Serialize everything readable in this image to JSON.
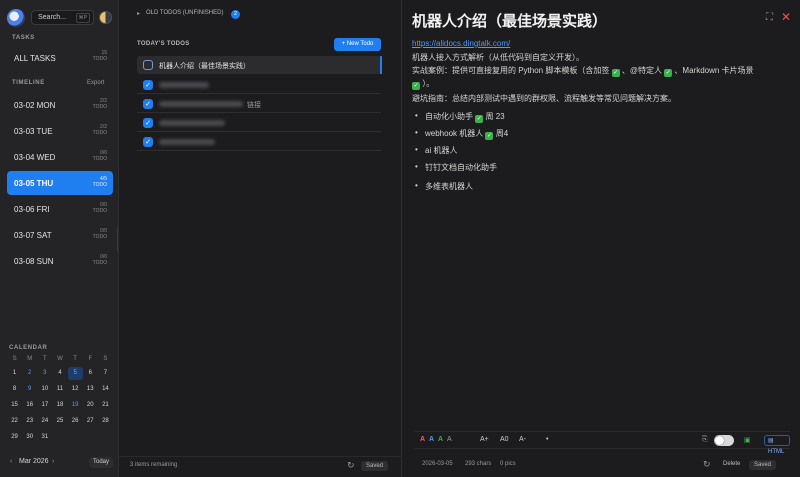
{
  "sidebar": {
    "search_placeholder": "Search...",
    "search_shortcut": "⌘P",
    "tasks_label": "TASKS",
    "all_tasks": {
      "label": "ALL TASKS",
      "count": "15",
      "unit": "TODO"
    },
    "timeline_label": "TIMELINE",
    "export_label": "Export",
    "days": [
      {
        "label": "03-02 MON",
        "count": "2/2",
        "unit": "TODO",
        "active": false
      },
      {
        "label": "03-03 TUE",
        "count": "2/2",
        "unit": "TODO",
        "active": false
      },
      {
        "label": "03-04 WED",
        "count": "0/0",
        "unit": "TODO",
        "active": false
      },
      {
        "label": "03-05 THU",
        "count": "4/5",
        "unit": "TODO",
        "active": true
      },
      {
        "label": "03-06 FRI",
        "count": "0/0",
        "unit": "TODO",
        "active": false
      },
      {
        "label": "03-07 SAT",
        "count": "0/0",
        "unit": "TODO",
        "active": false
      },
      {
        "label": "03-08 SUN",
        "count": "0/0",
        "unit": "TODO",
        "active": false
      }
    ],
    "calendar": {
      "label": "CALENDAR",
      "weekdays": [
        "S",
        "M",
        "T",
        "W",
        "T",
        "F",
        "S"
      ],
      "leading_blanks": 0,
      "days": [
        "1",
        "2",
        "3",
        "4",
        "5",
        "6",
        "7",
        "8",
        "9",
        "10",
        "11",
        "12",
        "13",
        "14",
        "15",
        "16",
        "17",
        "18",
        "19",
        "20",
        "21",
        "22",
        "23",
        "24",
        "25",
        "26",
        "27",
        "28",
        "29",
        "30",
        "31"
      ],
      "blue_days": [
        "2",
        "3",
        "9",
        "19"
      ],
      "selected_day": "5",
      "month_label": "Mar 2026",
      "prev": "‹",
      "next": "›",
      "today_label": "Today"
    }
  },
  "middle": {
    "old_todos_label": "OLD TODOS (UNFINISHED)",
    "old_todos_count": "2",
    "today_label": "TODAY'S TODOS",
    "new_todo_label": "+ New Todo",
    "todos": [
      {
        "text": "机器人介绍（最佳场景实践）",
        "done": false
      },
      {
        "text": "",
        "done": true
      },
      {
        "text": "",
        "suffix": "链接",
        "done": true
      },
      {
        "text": "",
        "done": true
      },
      {
        "text": "",
        "done": true
      }
    ],
    "remaining": "3 items remaining",
    "saved": "Saved"
  },
  "detail": {
    "title": "机器人介绍（最佳场景实践）",
    "link": "https://alidocs.dingtalk.com/",
    "line1": "机器人接入方式解析（从低代码到自定义开发）。",
    "line2a": "实战案例：提供可直接复用的 Python 脚本模板（含加签",
    "line2b": "、@特定人",
    "line2c": "、Markdown 卡片场景",
    "line2d": "）。",
    "line3": "避坑指南：总结内部测试中遇到的群权限、流程触发等常见问题解决方案。",
    "bullets": [
      {
        "a": "自动化小助手",
        "check": true,
        "b": "周 23"
      },
      {
        "a": "webhook 机器人",
        "check": true,
        "b": "周4"
      },
      {
        "a": "ai 机器人",
        "check": false,
        "b": ""
      },
      {
        "a": "钉钉文档自动化助手",
        "check": false,
        "b": ""
      },
      {
        "a": "多维表机器人",
        "check": false,
        "b": ""
      }
    ],
    "format": {
      "colors": [
        {
          "label": "A",
          "color": "#ff5a5a"
        },
        {
          "label": "A",
          "color": "#4f9cff"
        },
        {
          "label": "A",
          "color": "#3bb04f"
        },
        {
          "label": "A",
          "color": "#9a9a9a"
        }
      ],
      "font_up": "A+",
      "font_reset": "A0",
      "font_down": "A-",
      "bullet": "•",
      "html_label": "HTML"
    },
    "footer": {
      "date": "2026-03-05",
      "chars": "293 chars",
      "pics": "0 pics",
      "delete": "Delete",
      "saved": "Saved"
    }
  }
}
